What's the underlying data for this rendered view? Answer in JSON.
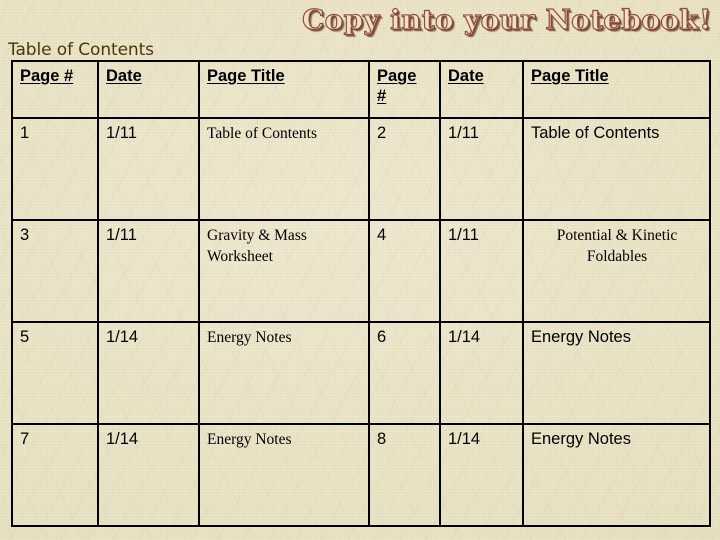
{
  "slide": {
    "headline": "Copy into your Notebook!",
    "caption": "Table of Contents",
    "colors": {
      "background": "#eae2c2",
      "border": "#000000",
      "caption_text": "#4a3806",
      "wordart_fill": "#f0e0cb",
      "wordart_outline": "#8e4f38",
      "wordart_shadow": "#6d3c2b",
      "body_text": "#000000"
    }
  },
  "table": {
    "headers": [
      "Page #",
      "Date",
      "Page Title",
      "Page #",
      "Date",
      "Page Title"
    ],
    "header_4_line1": "Page",
    "header_4_line2": "#",
    "rows": [
      {
        "left_page": "1",
        "left_date": "1/11",
        "left_title": "Table of Contents",
        "right_page": "2",
        "right_date": "1/11",
        "right_title": "Table of Contents"
      },
      {
        "left_page": "3",
        "left_date": "1/11",
        "left_title": "Gravity & Mass Worksheet",
        "right_page": "4",
        "right_date": "1/11",
        "right_title": "Potential & Kinetic Foldables"
      },
      {
        "left_page": "5",
        "left_date": "1/14",
        "left_title": "Energy Notes",
        "right_page": "6",
        "right_date": "1/14",
        "right_title": "Energy Notes"
      },
      {
        "left_page": "7",
        "left_date": "1/14",
        "left_title": "Energy Notes",
        "right_page": "8",
        "right_date": "1/14",
        "right_title": "Energy Notes"
      }
    ]
  }
}
